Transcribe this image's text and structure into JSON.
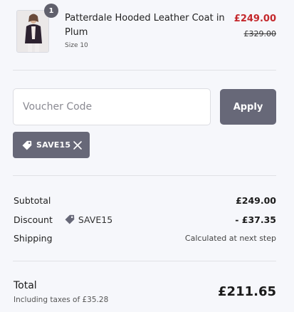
{
  "product": {
    "quantity": "1",
    "title": "Patterdale Hooded Leather Coat in Plum",
    "size": "Size 10",
    "price": "£249.00",
    "original_price": "£329.00"
  },
  "voucher": {
    "placeholder": "Voucher Code",
    "value": "",
    "apply_label": "Apply",
    "applied_code": "SAVE15"
  },
  "summary": {
    "subtotal_label": "Subtotal",
    "subtotal_value": "£249.00",
    "discount_label": "Discount",
    "discount_code": "SAVE15",
    "discount_value": "- £37.35",
    "shipping_label": "Shipping",
    "shipping_value": "Calculated at next step",
    "total_label": "Total",
    "tax_note": "Including taxes of £35.28",
    "total_value": "£211.65"
  },
  "colors": {
    "sale_price": "#c4282c",
    "button": "#676878",
    "background": "#f6f7fb"
  },
  "icons": {
    "tag": "tag-icon",
    "remove": "close-icon"
  }
}
